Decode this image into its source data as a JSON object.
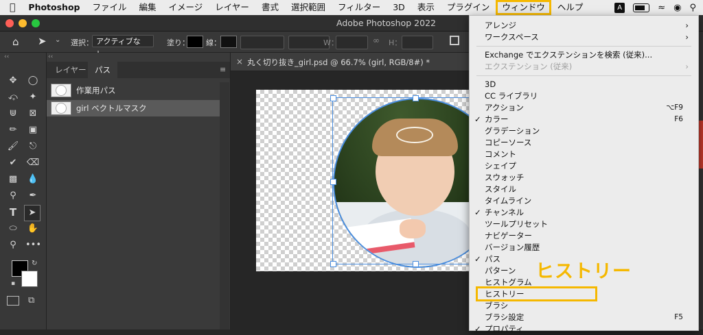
{
  "menubar": {
    "app_name": "Photoshop",
    "items": [
      "ファイル",
      "編集",
      "イメージ",
      "レイヤー",
      "書式",
      "選択範囲",
      "フィルター",
      "3D",
      "表示",
      "プラグイン",
      "ウィンドウ",
      "ヘルプ"
    ],
    "active_item": "ウィンドウ",
    "input_indicator": "A"
  },
  "window": {
    "title": "Adobe Photoshop 2022"
  },
  "options_bar": {
    "select_label": "選択：",
    "select_value": "アクティブなレ…",
    "fill_label": "塗り：",
    "stroke_label": "線：",
    "w_label": "W：",
    "h_label": "H："
  },
  "panel": {
    "tabs": [
      "レイヤー",
      "パス"
    ],
    "selected_tab": "パス",
    "paths": [
      {
        "name": "作業用パス"
      },
      {
        "name": "girl ベクトルマスク"
      }
    ]
  },
  "document": {
    "tab_title": "丸く切り抜き_girl.psd @ 66.7% (girl, RGB/8#) *"
  },
  "window_menu": {
    "items": [
      {
        "label": "アレンジ",
        "submenu": true
      },
      {
        "label": "ワークスペース",
        "submenu": true
      },
      {
        "sep": true
      },
      {
        "label": "Exchange でエクステンションを検索 (従来)..."
      },
      {
        "label": "エクステンション (従来)",
        "submenu": true,
        "disabled": true
      },
      {
        "sep": true
      },
      {
        "label": "3D"
      },
      {
        "label": "CC ライブラリ"
      },
      {
        "label": "アクション",
        "shortcut": "⌥F9"
      },
      {
        "label": "カラー",
        "checked": true,
        "shortcut": "F6"
      },
      {
        "label": "グラデーション"
      },
      {
        "label": "コピーソース"
      },
      {
        "label": "コメント"
      },
      {
        "label": "シェイプ"
      },
      {
        "label": "スウォッチ"
      },
      {
        "label": "スタイル"
      },
      {
        "label": "タイムライン"
      },
      {
        "label": "チャンネル",
        "checked": true
      },
      {
        "label": "ツールプリセット"
      },
      {
        "label": "ナビゲーター"
      },
      {
        "label": "バージョン履歴"
      },
      {
        "label": "パス",
        "checked": true
      },
      {
        "label": "パターン"
      },
      {
        "label": "ヒストグラム"
      },
      {
        "label": "ヒストリー"
      },
      {
        "label": "ブラシ"
      },
      {
        "label": "ブラシ設定",
        "shortcut": "F5"
      },
      {
        "label": "プロパティ",
        "checked": true
      }
    ]
  },
  "annotation": {
    "callout_text": "ヒストリー",
    "color": "#f5b800"
  }
}
